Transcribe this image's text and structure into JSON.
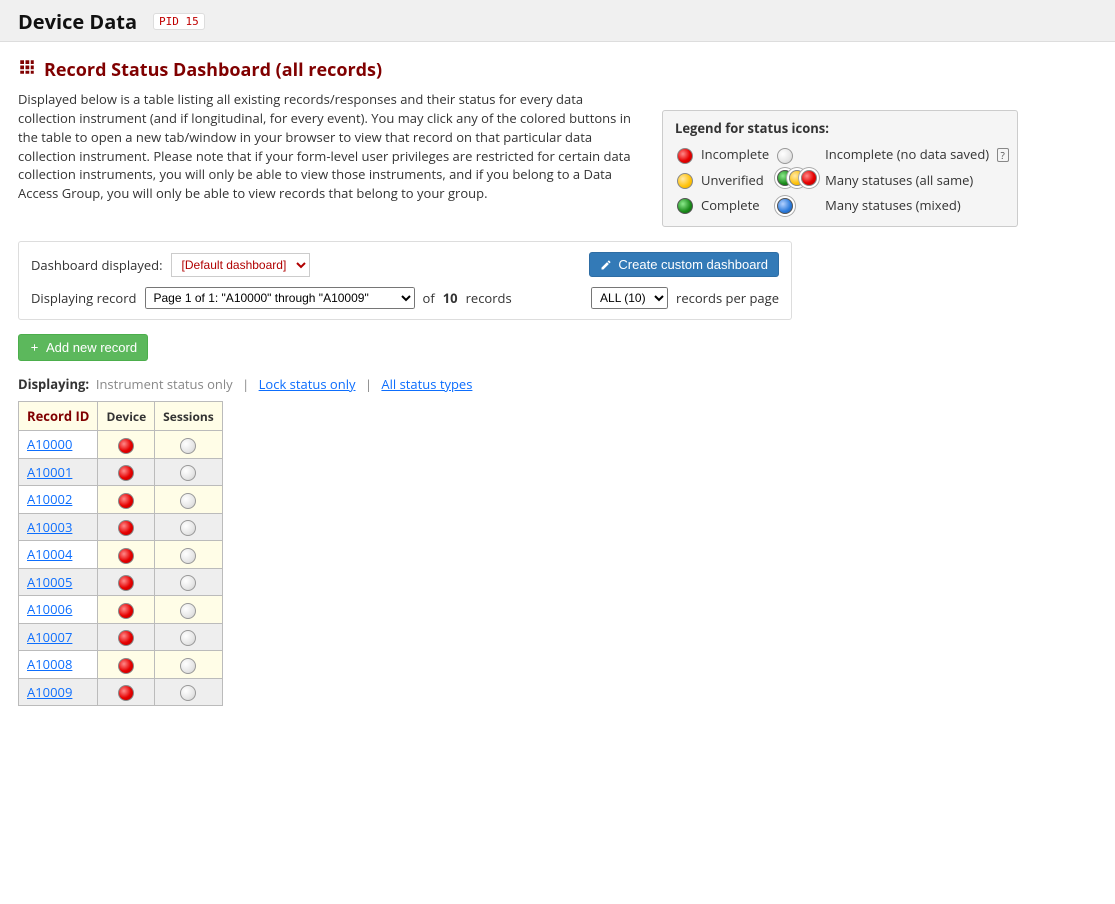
{
  "header": {
    "project_title": "Device Data",
    "pid_badge": "PID 15"
  },
  "page": {
    "title": "Record Status Dashboard (all records)",
    "intro": "Displayed below is a table listing all existing records/responses and their status for every data collection instrument (and if longitudinal, for every event). You may click any of the colored buttons in the table to open a new tab/window in your browser to view that record on that particular data collection instrument. Please note that if your form-level user privileges are restricted for certain data collection instruments, you will only be able to view those instruments, and if you belong to a Data Access Group, you will only be able to view records that belong to your group."
  },
  "legend": {
    "title": "Legend for status icons:",
    "incomplete": "Incomplete",
    "incomplete_nodata": "Incomplete (no data saved)",
    "unverified": "Unverified",
    "many_same": "Many statuses (all same)",
    "complete": "Complete",
    "many_mixed": "Many statuses (mixed)"
  },
  "controls": {
    "dashboard_label": "Dashboard displayed:",
    "dashboard_value": "[Default dashboard]",
    "create_custom": "Create custom dashboard",
    "displaying_label": "Displaying record",
    "page_value": "Page 1 of 1: \"A10000\" through \"A10009\"",
    "of_text": "of",
    "total_records": "10",
    "records_text": "records",
    "per_page_value": "ALL (10)",
    "per_page_label": "records per page"
  },
  "add_button": "Add new record",
  "filters": {
    "label": "Displaying:",
    "opt1": "Instrument status only",
    "opt2": "Lock status only",
    "opt3": "All status types"
  },
  "table": {
    "col_record": "Record ID",
    "col_device": "Device",
    "col_sessions": "Sessions",
    "rows": [
      {
        "id": "A10000",
        "device": "red",
        "sessions": "gray"
      },
      {
        "id": "A10001",
        "device": "red",
        "sessions": "gray"
      },
      {
        "id": "A10002",
        "device": "red",
        "sessions": "gray"
      },
      {
        "id": "A10003",
        "device": "red",
        "sessions": "gray"
      },
      {
        "id": "A10004",
        "device": "red",
        "sessions": "gray"
      },
      {
        "id": "A10005",
        "device": "red",
        "sessions": "gray"
      },
      {
        "id": "A10006",
        "device": "red",
        "sessions": "gray"
      },
      {
        "id": "A10007",
        "device": "red",
        "sessions": "gray"
      },
      {
        "id": "A10008",
        "device": "red",
        "sessions": "gray"
      },
      {
        "id": "A10009",
        "device": "red",
        "sessions": "gray"
      }
    ]
  }
}
